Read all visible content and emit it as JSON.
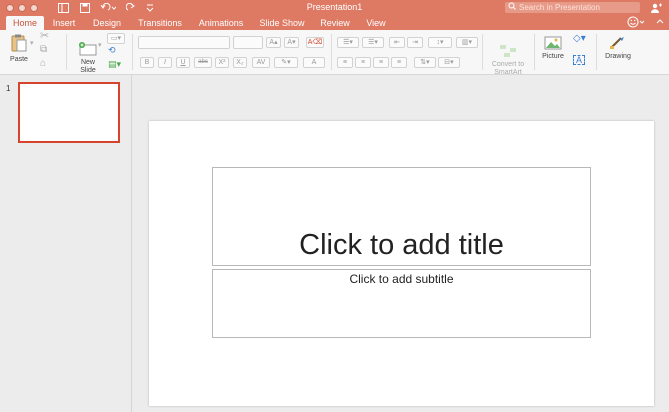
{
  "window": {
    "title": "Presentation1"
  },
  "search": {
    "placeholder": "Search in Presentation"
  },
  "tabs": [
    "Home",
    "Insert",
    "Design",
    "Transitions",
    "Animations",
    "Slide Show",
    "Review",
    "View"
  ],
  "ribbon": {
    "paste_label": "Paste",
    "new_slide_label": "New\nSlide",
    "convert_label": "Convert to\nSmartArt",
    "picture_label": "Picture",
    "drawing_label": "Drawing",
    "font_size_up": "A▴",
    "font_size_down": "A▾",
    "bold": "B",
    "italic": "I",
    "underline": "U",
    "strike": "abc",
    "superscript": "X²",
    "subscript": "X₂",
    "char_spacing": "AV",
    "font_color": "A"
  },
  "thumbnails": [
    {
      "number": "1"
    }
  ],
  "slide": {
    "title_placeholder": "Click to add title",
    "subtitle_placeholder": "Click to add subtitle"
  },
  "colors": {
    "accent": "#de7a64",
    "selection": "#d7442d"
  }
}
